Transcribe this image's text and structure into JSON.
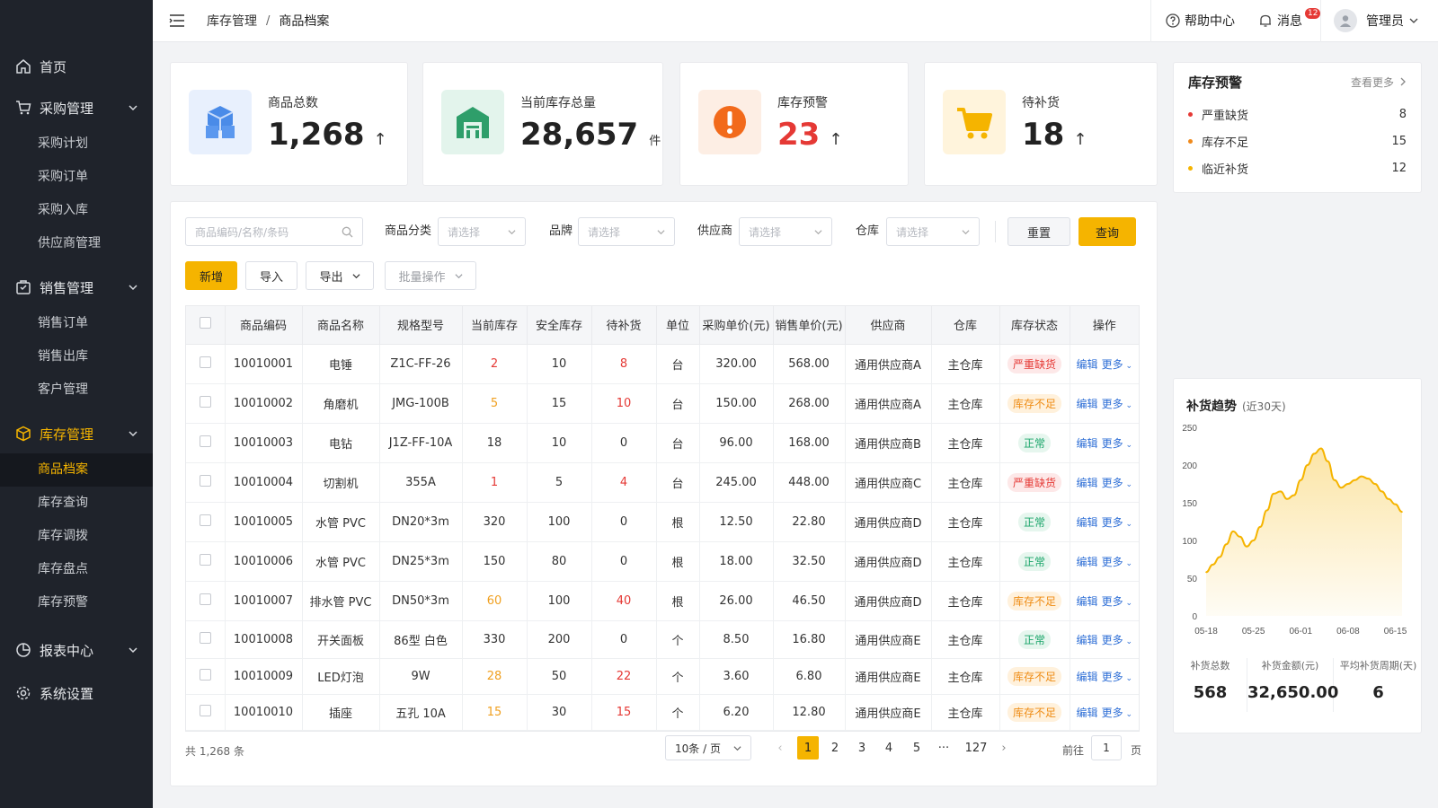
{
  "sidebar": {
    "home": "首页",
    "purchase": {
      "label": "采购管理",
      "items": [
        "采购计划",
        "采购订单",
        "采购入库",
        "供应商管理"
      ]
    },
    "sales": {
      "label": "销售管理",
      "items": [
        "销售订单",
        "销售出库",
        "客户管理"
      ]
    },
    "inventory": {
      "label": "库存管理",
      "items": [
        "商品档案",
        "库存查询",
        "库存调拨",
        "库存盘点",
        "库存预警"
      ]
    },
    "reports": "报表中心",
    "settings": "系统设置"
  },
  "topbar": {
    "crumb1": "库存管理",
    "sep": "/",
    "crumb2": "商品档案",
    "help": "帮助中心",
    "msg": "消息",
    "msg_count": "12",
    "user": "管理员"
  },
  "stats": [
    {
      "label": "商品总数",
      "value": "1,268",
      "arrow": "↑",
      "unit": ""
    },
    {
      "label": "当前库存总量",
      "value": "28,657",
      "arrow": "",
      "unit": "件"
    },
    {
      "label": "库存预警",
      "value": "23",
      "arrow": "↑",
      "unit": ""
    },
    {
      "label": "待补货",
      "value": "18",
      "arrow": "↑",
      "unit": ""
    }
  ],
  "filters": {
    "search_placeholder": "商品编码/名称/条码",
    "category_label": "商品分类",
    "brand_label": "品牌",
    "supplier_label": "供应商",
    "warehouse_label": "仓库",
    "select_placeholder": "请选择",
    "reset": "重置",
    "query": "查询"
  },
  "actions": {
    "add": "新增",
    "import": "导入",
    "export": "导出",
    "batch": "批量操作"
  },
  "table": {
    "headers": [
      "商品编码",
      "商品名称",
      "规格型号",
      "当前库存",
      "安全库存",
      "待补货",
      "单位",
      "采购单价(元)",
      "销售单价(元)",
      "供应商",
      "仓库",
      "库存状态",
      "操作"
    ],
    "rows": [
      [
        "10010001",
        "电锤",
        "Z1C-FF-26",
        "2",
        "10",
        "8",
        "台",
        "320.00",
        "568.00",
        "通用供应商A",
        "主仓库",
        "严重缺货"
      ],
      [
        "10010002",
        "角磨机",
        "JMG-100B",
        "5",
        "15",
        "10",
        "台",
        "150.00",
        "268.00",
        "通用供应商A",
        "主仓库",
        "库存不足"
      ],
      [
        "10010003",
        "电钻",
        "J1Z-FF-10A",
        "18",
        "10",
        "0",
        "台",
        "96.00",
        "168.00",
        "通用供应商B",
        "主仓库",
        "正常"
      ],
      [
        "10010004",
        "切割机",
        "355A",
        "1",
        "5",
        "4",
        "台",
        "245.00",
        "448.00",
        "通用供应商C",
        "主仓库",
        "严重缺货"
      ],
      [
        "10010005",
        "水管 PVC",
        "DN20*3m",
        "320",
        "100",
        "0",
        "根",
        "12.50",
        "22.80",
        "通用供应商D",
        "主仓库",
        "正常"
      ],
      [
        "10010006",
        "水管 PVC",
        "DN25*3m",
        "150",
        "80",
        "0",
        "根",
        "18.00",
        "32.50",
        "通用供应商D",
        "主仓库",
        "正常"
      ],
      [
        "10010007",
        "排水管 PVC",
        "DN50*3m",
        "60",
        "100",
        "40",
        "根",
        "26.00",
        "46.50",
        "通用供应商D",
        "主仓库",
        "库存不足"
      ],
      [
        "10010008",
        "开关面板",
        "86型 白色",
        "330",
        "200",
        "0",
        "个",
        "8.50",
        "16.80",
        "通用供应商E",
        "主仓库",
        "正常"
      ],
      [
        "10010009",
        "LED灯泡",
        "9W",
        "28",
        "50",
        "22",
        "个",
        "3.60",
        "6.80",
        "通用供应商E",
        "主仓库",
        "库存不足"
      ],
      [
        "10010010",
        "插座",
        "五孔 10A",
        "15",
        "30",
        "15",
        "个",
        "6.20",
        "12.80",
        "通用供应商E",
        "主仓库",
        "库存不足"
      ]
    ],
    "op_edit": "编辑",
    "op_more": "更多"
  },
  "pagination": {
    "total": "共 1,268 条",
    "page_size": "10条 / 页",
    "pages": [
      "1",
      "2",
      "3",
      "4",
      "5",
      "···",
      "127"
    ],
    "goto": "前往",
    "goto_value": "1",
    "page_unit": "页"
  },
  "alerts": {
    "title": "库存预警",
    "more": "查看更多",
    "items": [
      {
        "label": "严重缺货",
        "count": "8",
        "color": "#e53935"
      },
      {
        "label": "库存不足",
        "count": "15",
        "color": "#f08a1c"
      },
      {
        "label": "临近补货",
        "count": "12",
        "color": "#f5b400"
      }
    ]
  },
  "trend": {
    "title": "补货趋势",
    "subtitle": "(近30天)",
    "summary": [
      {
        "label": "补货总数",
        "value": "568"
      },
      {
        "label": "补货金额(元)",
        "value": "32,650.00"
      },
      {
        "label": "平均补货周期(天)",
        "value": "6"
      }
    ]
  },
  "chart_data": {
    "type": "area",
    "x": [
      "05-18",
      "05-19",
      "05-20",
      "05-21",
      "05-22",
      "05-23",
      "05-24",
      "05-25",
      "05-26",
      "05-27",
      "05-28",
      "05-29",
      "05-30",
      "05-31",
      "06-01",
      "06-02",
      "06-03",
      "06-04",
      "06-05",
      "06-06",
      "06-07",
      "06-08",
      "06-09",
      "06-10",
      "06-11",
      "06-12",
      "06-13",
      "06-14",
      "06-15",
      "06-16"
    ],
    "series": [
      {
        "values": [
          58,
          68,
          78,
          95,
          112,
          105,
          92,
          100,
          118,
          140,
          162,
          165,
          155,
          160,
          180,
          200,
          215,
          222,
          205,
          180,
          170,
          175,
          180,
          185,
          182,
          175,
          165,
          155,
          148,
          138
        ]
      }
    ],
    "x_ticks": [
      "05-18",
      "05-25",
      "06-01",
      "06-08",
      "06-15"
    ],
    "y_ticks": [
      0,
      50,
      100,
      150,
      200,
      250
    ],
    "ylim": [
      0,
      250
    ],
    "color": "#f5b400"
  }
}
